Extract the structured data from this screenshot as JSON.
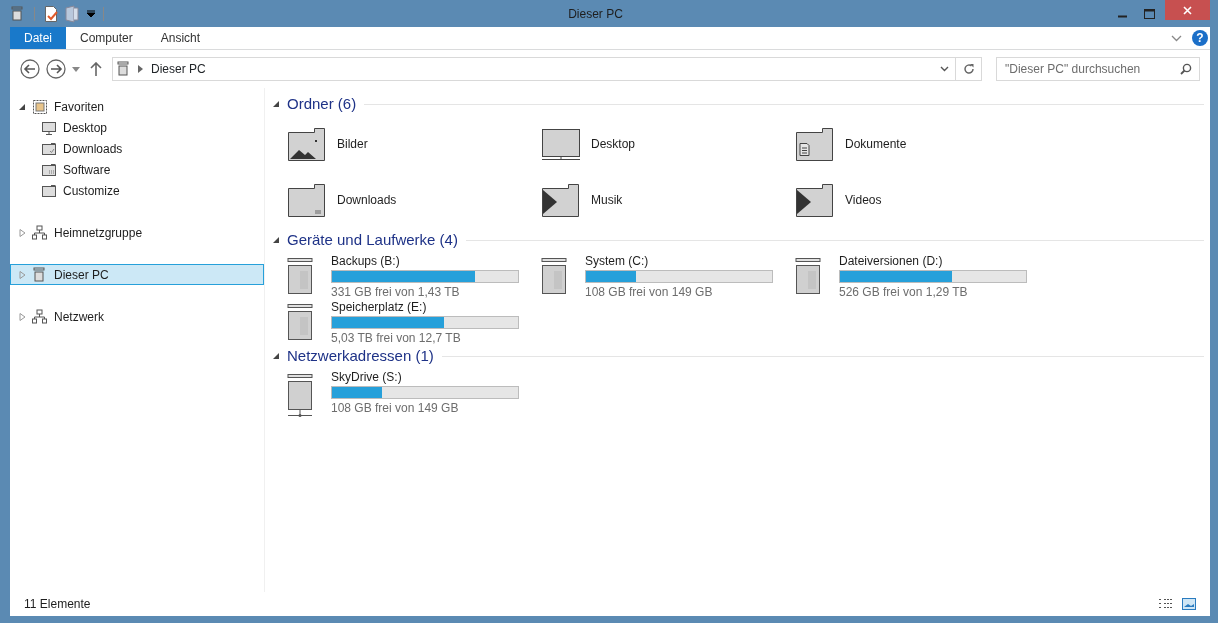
{
  "window": {
    "title": "Dieser PC"
  },
  "ribbon_tabs": [
    {
      "label": "Datei",
      "selected": true
    },
    {
      "label": "Computer",
      "selected": false
    },
    {
      "label": "Ansicht",
      "selected": false
    }
  ],
  "help": {
    "label": "?"
  },
  "address": {
    "path": "Dieser PC"
  },
  "search": {
    "placeholder": "\"Dieser PC\" durchsuchen"
  },
  "sidebar": {
    "items": [
      {
        "label": "Favoriten",
        "kind": "favorites",
        "expanded": true,
        "selected": false,
        "children": [
          {
            "label": "Desktop",
            "kind": "desktop",
            "selected": false
          },
          {
            "label": "Downloads",
            "kind": "downloads",
            "selected": false
          },
          {
            "label": "Software",
            "kind": "folder-dots",
            "selected": false
          },
          {
            "label": "Customize",
            "kind": "folder",
            "selected": false
          }
        ]
      },
      {
        "label": "Heimnetzgruppe",
        "kind": "network",
        "expanded": false,
        "selected": false
      },
      {
        "label": "Dieser PC",
        "kind": "pc",
        "expanded": false,
        "selected": true
      },
      {
        "label": "Netzwerk",
        "kind": "network",
        "expanded": false,
        "selected": false
      }
    ]
  },
  "groups": [
    {
      "title": "Ordner (6)",
      "kind": "folders",
      "items": [
        {
          "name": "Bilder",
          "kind": "pictures"
        },
        {
          "name": "Desktop",
          "kind": "desktop"
        },
        {
          "name": "Dokumente",
          "kind": "documents"
        },
        {
          "name": "Downloads",
          "kind": "downloads"
        },
        {
          "name": "Musik",
          "kind": "music"
        },
        {
          "name": "Videos",
          "kind": "videos"
        }
      ]
    },
    {
      "title": "Geräte und Laufwerke (4)",
      "kind": "drives",
      "items": [
        {
          "name": "Backups (B:)",
          "kind": "drive",
          "level": 0.77,
          "reading": "331 GB frei von 1,43 TB"
        },
        {
          "name": "System (C:)",
          "kind": "drive",
          "level": 0.27,
          "reading": "108 GB frei von 149 GB"
        },
        {
          "name": "Dateiversionen (D:)",
          "kind": "drive",
          "level": 0.6,
          "reading": "526 GB frei von 1,29 TB"
        },
        {
          "name": "Speicherplatz (E:)",
          "kind": "drive",
          "level": 0.6,
          "reading": "5,03 TB frei von 12,7 TB"
        }
      ]
    },
    {
      "title": "Netzwerkadressen (1)",
      "kind": "drives",
      "items": [
        {
          "name": "SkyDrive (S:)",
          "kind": "network-drive",
          "level": 0.27,
          "reading": "108 GB frei von 149 GB"
        }
      ]
    }
  ],
  "status_bar": {
    "count": "11 Elemente"
  }
}
